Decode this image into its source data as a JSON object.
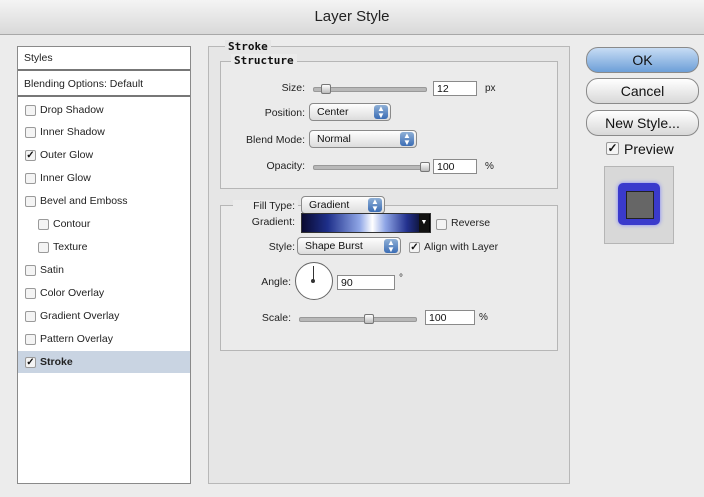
{
  "window": {
    "title": "Layer Style"
  },
  "styles_list": {
    "header": "Styles",
    "blending": "Blending Options: Default",
    "items": [
      {
        "label": "Drop Shadow",
        "checked": false
      },
      {
        "label": "Inner Shadow",
        "checked": false
      },
      {
        "label": "Outer Glow",
        "checked": true
      },
      {
        "label": "Inner Glow",
        "checked": false
      },
      {
        "label": "Bevel and Emboss",
        "checked": false
      },
      {
        "label": "Contour",
        "checked": false
      },
      {
        "label": "Texture",
        "checked": false
      },
      {
        "label": "Satin",
        "checked": false
      },
      {
        "label": "Color Overlay",
        "checked": false
      },
      {
        "label": "Gradient Overlay",
        "checked": false
      },
      {
        "label": "Pattern Overlay",
        "checked": false
      },
      {
        "label": "Stroke",
        "checked": true,
        "selected": true
      }
    ]
  },
  "stroke": {
    "title": "Stroke",
    "structure_title": "Structure",
    "size": {
      "label": "Size:",
      "value": "12",
      "unit": "px"
    },
    "position": {
      "label": "Position:",
      "value": "Center"
    },
    "blend_mode": {
      "label": "Blend Mode:",
      "value": "Normal"
    },
    "opacity": {
      "label": "Opacity:",
      "value": "100",
      "unit": "%"
    },
    "fill_type": {
      "label": "Fill Type:",
      "value": "Gradient"
    },
    "gradient": {
      "label": "Gradient:",
      "reverse_label": "Reverse",
      "reverse": false
    },
    "style": {
      "label": "Style:",
      "value": "Shape Burst",
      "align_label": "Align with Layer",
      "align": true
    },
    "angle": {
      "label": "Angle:",
      "value": "90",
      "unit": "°"
    },
    "scale": {
      "label": "Scale:",
      "value": "100",
      "unit": "%"
    }
  },
  "buttons": {
    "ok": "OK",
    "cancel": "Cancel",
    "new_style": "New Style..."
  },
  "preview": {
    "label": "Preview",
    "checked": true
  }
}
